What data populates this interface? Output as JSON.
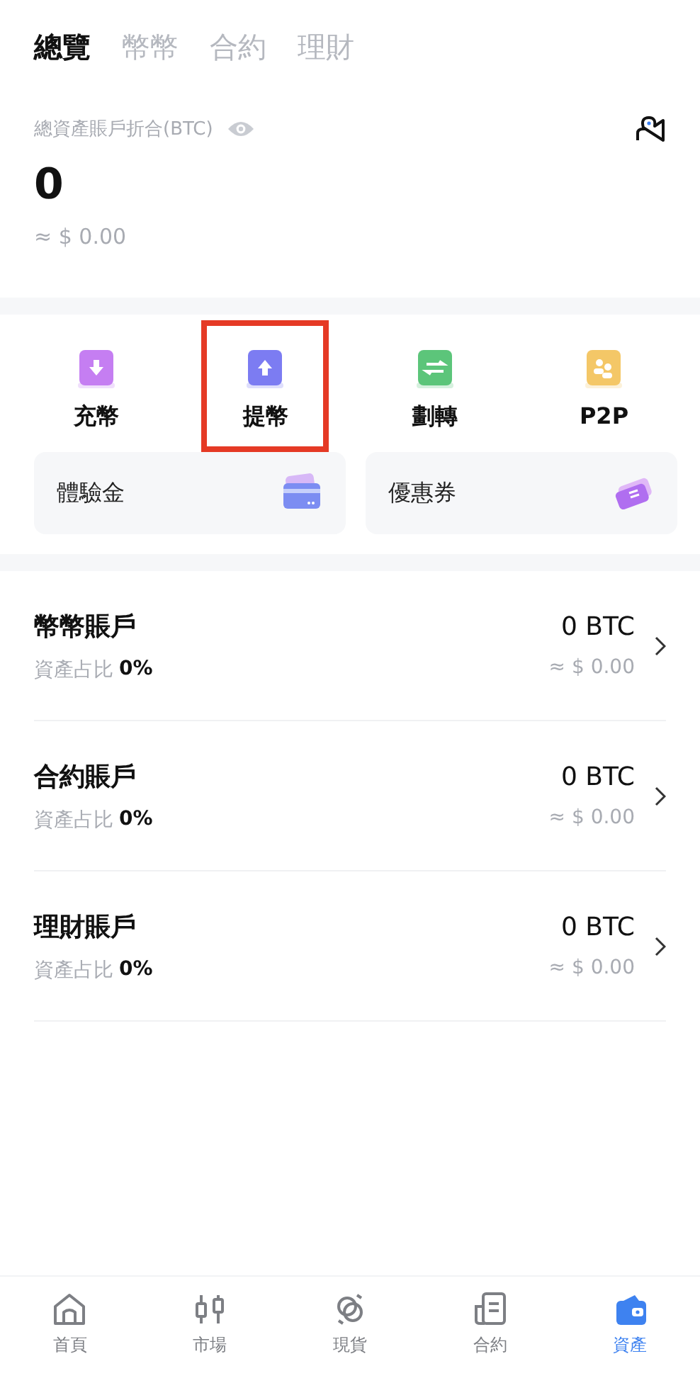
{
  "tabs": [
    {
      "label": "總覽",
      "selected": true
    },
    {
      "label": "幣幣",
      "selected": false
    },
    {
      "label": "合約",
      "selected": false
    },
    {
      "label": "理財",
      "selected": false
    }
  ],
  "summary": {
    "label": "總資產賬戶折合(BTC)",
    "value": "0",
    "fiat": "≈ $ 0.00"
  },
  "actions": [
    {
      "label": "充幣",
      "kind": "deposit",
      "color": "#c57ef2",
      "highlighted": false
    },
    {
      "label": "提幣",
      "kind": "withdraw",
      "color": "#7c7cf2",
      "highlighted": true
    },
    {
      "label": "劃轉",
      "kind": "transfer",
      "color": "#5cc57a",
      "highlighted": false
    },
    {
      "label": "P2P",
      "kind": "p2p",
      "color": "#f4c767",
      "highlighted": false
    }
  ],
  "cards": [
    {
      "label": "體驗金",
      "kind": "card"
    },
    {
      "label": "優惠券",
      "kind": "coupon"
    }
  ],
  "accounts": [
    {
      "name": "幣幣賬戶",
      "share_label": "資產占比",
      "share_value": "0%",
      "amount": "0 BTC",
      "fiat": "≈ $ 0.00"
    },
    {
      "name": "合約賬戶",
      "share_label": "資產占比",
      "share_value": "0%",
      "amount": "0 BTC",
      "fiat": "≈ $ 0.00"
    },
    {
      "name": "理財賬戶",
      "share_label": "資產占比",
      "share_value": "0%",
      "amount": "0 BTC",
      "fiat": "≈ $ 0.00"
    }
  ],
  "nav": [
    {
      "label": "首頁",
      "kind": "home",
      "selected": false
    },
    {
      "label": "市場",
      "kind": "market",
      "selected": false
    },
    {
      "label": "現貨",
      "kind": "spot",
      "selected": false
    },
    {
      "label": "合約",
      "kind": "contract",
      "selected": false
    },
    {
      "label": "資產",
      "kind": "assets",
      "selected": true
    }
  ]
}
